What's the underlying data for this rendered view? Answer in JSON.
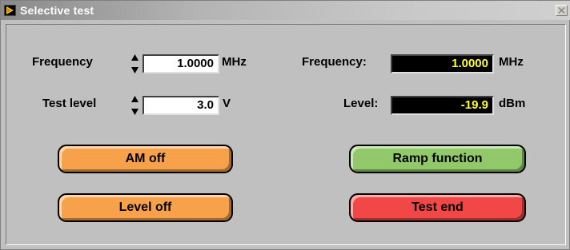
{
  "window": {
    "title": "Selective test"
  },
  "left": {
    "frequency": {
      "label": "Frequency",
      "value": "1.0000",
      "unit": "MHz"
    },
    "test_level": {
      "label": "Test level",
      "value": "3.0",
      "unit": "V"
    }
  },
  "right": {
    "frequency": {
      "label": "Frequency:",
      "value": "1.0000",
      "unit": "MHz"
    },
    "level": {
      "label": "Level:",
      "value": "-19.9",
      "unit": "dBm"
    }
  },
  "buttons": {
    "am_off": "AM off",
    "ramp_function": "Ramp function",
    "level_off": "Level off",
    "test_end": "Test end"
  },
  "colors": {
    "orange": "#f7a24a",
    "green": "#91c96a",
    "red": "#f24747",
    "indicator_text": "#ffff33"
  }
}
